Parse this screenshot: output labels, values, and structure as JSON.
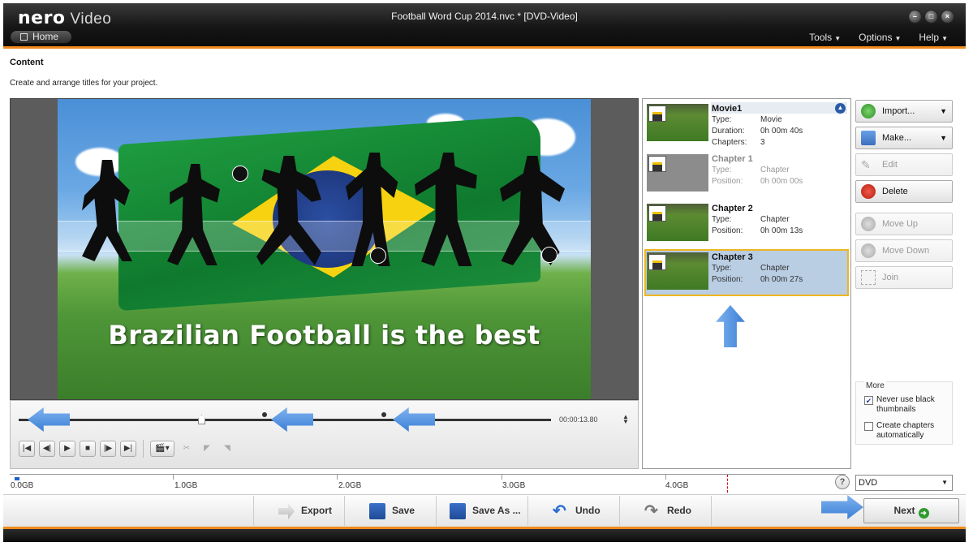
{
  "app": {
    "brand": "nero",
    "product": "Video",
    "window_title": "Football Word Cup 2014.nvc * [DVD-Video]"
  },
  "nav": {
    "home_label": "Home",
    "menu": [
      {
        "label": "Tools"
      },
      {
        "label": "Options"
      },
      {
        "label": "Help"
      }
    ]
  },
  "header": {
    "title": "Content",
    "subtitle": "Create and arrange titles for your project."
  },
  "preview": {
    "caption": "Brazilian Football is the best",
    "timecode": "00:00:13.80"
  },
  "content_list": [
    {
      "name": "Movie1",
      "rows": [
        {
          "key": "Type:",
          "value": "Movie"
        },
        {
          "key": "Duration:",
          "value": "0h 00m 40s"
        },
        {
          "key": "Chapters:",
          "value": "3"
        }
      ]
    },
    {
      "name": "Chapter 1",
      "rows": [
        {
          "key": "Type:",
          "value": "Chapter"
        },
        {
          "key": "Position:",
          "value": "0h 00m 00s"
        }
      ]
    },
    {
      "name": "Chapter 2",
      "rows": [
        {
          "key": "Type:",
          "value": "Chapter"
        },
        {
          "key": "Position:",
          "value": "0h 00m 13s"
        }
      ]
    },
    {
      "name": "Chapter 3",
      "rows": [
        {
          "key": "Type:",
          "value": "Chapter"
        },
        {
          "key": "Position:",
          "value": "0h 00m 27s"
        }
      ]
    }
  ],
  "actions": {
    "import": "Import...",
    "make": "Make...",
    "edit": "Edit",
    "delete": "Delete",
    "move_up": "Move Up",
    "move_down": "Move Down",
    "join": "Join"
  },
  "more": {
    "title": "More",
    "never_black": "Never use black thumbnails",
    "create_chapters": "Create chapters automatically",
    "never_black_checked": true,
    "create_chapters_checked": false
  },
  "capacity": {
    "labels": [
      "0.0GB",
      "1.0GB",
      "2.0GB",
      "3.0GB",
      "4.0GB"
    ],
    "disc_type": "DVD"
  },
  "toolbar": {
    "export": "Export",
    "save": "Save",
    "save_as": "Save As ...",
    "undo": "Undo",
    "redo": "Redo",
    "next": "Next"
  },
  "colors": {
    "accent": "#f08a1c",
    "selection": "#b9cde3",
    "selection_border": "#f0b520",
    "arrow": "#4a8be0"
  }
}
